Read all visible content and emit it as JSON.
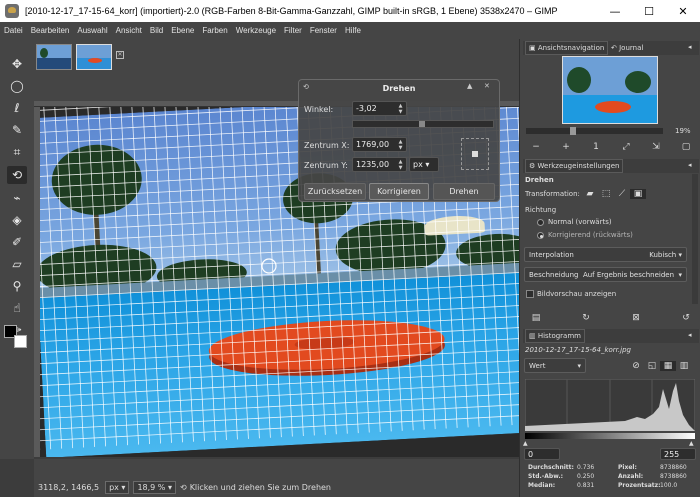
{
  "window": {
    "title": "[2010-12-17_17-15-64_korr] (importiert)-2.0 (RGB-Farben 8-Bit-Gamma-Ganzzahl, GIMP built-in sRGB, 1 Ebene) 3538x2470 – GIMP",
    "minimize": "—",
    "maximize": "☐",
    "close": "✕"
  },
  "menu": [
    "Datei",
    "Bearbeiten",
    "Auswahl",
    "Ansicht",
    "Bild",
    "Ebene",
    "Farben",
    "Werkzeuge",
    "Filter",
    "Fenster",
    "Hilfe"
  ],
  "rotate_dialog": {
    "title": "Drehen",
    "angle_label": "Winkel:",
    "angle_value": "-3,02",
    "center_x_label": "Zentrum X:",
    "center_x_value": "1769,00",
    "center_y_label": "Zentrum Y:",
    "center_y_value": "1235,00",
    "unit": "px",
    "reset_button": "Zurücksetzen",
    "correct_button": "Korrigieren",
    "rotate_button": "Drehen"
  },
  "status": {
    "coordinates": "3118,2, 1466,5",
    "unit": "px",
    "zoom": "18,9 %",
    "message": "Klicken und ziehen Sie zum Drehen"
  },
  "navigation": {
    "tab1": "Ansichtsnavigation",
    "tab2": "Journal",
    "zoom": "19%"
  },
  "tool_options": {
    "tab": "Werkzeugeinstellungen",
    "tool_name": "Drehen",
    "transformation_label": "Transformation:",
    "direction_label": "Richtung",
    "direction_normal": "Normal (vorwärts)",
    "direction_corrective": "Korrigierend (rückwärts)",
    "interpolation_label": "Interpolation",
    "interpolation_value": "Kubisch",
    "clipping_label": "Beschneidung",
    "clipping_value": "Auf Ergebnis beschneiden",
    "preview_label": "Bildvorschau anzeigen"
  },
  "histogram": {
    "tab": "Histogramm",
    "filename": "2010-12-17_17-15-64_korr.jpg",
    "channel": "Wert",
    "range_min": "0",
    "range_max": "255",
    "mean_label": "Durchschnitt:",
    "mean": "0.736",
    "std_label": "Std.-Abw.:",
    "std": "0.250",
    "median_label": "Median:",
    "median": "0.831",
    "pixels_label": "Pixel:",
    "pixels": "8738860",
    "count_label": "Anzahl:",
    "count": "8738860",
    "percentile_label": "Prozentsatz:",
    "percentile": "100.0"
  }
}
